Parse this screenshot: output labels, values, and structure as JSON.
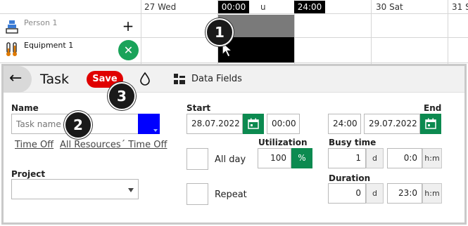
{
  "timeline": {
    "days": [
      {
        "label": "27 Wed"
      },
      {
        "label": "u"
      },
      {
        "label": "30 Sat"
      },
      {
        "label": "31 S"
      }
    ],
    "time_badges": {
      "start": "00:00",
      "end": "24:00"
    },
    "resources": [
      {
        "name": "Person 1",
        "icon": "person-icon",
        "action": "+"
      },
      {
        "name": "Equipment 1",
        "icon": "equipment-icon",
        "action": "✕"
      }
    ],
    "colors": {
      "selection": "#000000",
      "existing_block": "#7a7a7a",
      "remove_button": "#1aa35a"
    }
  },
  "markers": [
    "1",
    "2",
    "3"
  ],
  "dialog": {
    "title": "Task",
    "save_label": "Save",
    "data_fields_label": "Data Fields",
    "name": {
      "label": "Name",
      "placeholder": "Task name",
      "value": "",
      "color": "#0000ff"
    },
    "links": {
      "time_off": "Time Off",
      "all_time_off": "All Resources´ Time Off"
    },
    "project": {
      "label": "Project",
      "value": ""
    },
    "start": {
      "label": "Start",
      "date": "28.07.2022",
      "time": "00:00"
    },
    "end": {
      "label": "End",
      "date": "29.07.2022",
      "time": "24:00"
    },
    "all_day": {
      "label": "All day",
      "checked": false
    },
    "repeat": {
      "label": "Repeat",
      "checked": false
    },
    "utilization": {
      "label": "Utilization",
      "value": "100",
      "unit": "%"
    },
    "busy_time": {
      "label": "Busy time",
      "days": "1",
      "days_unit": "d",
      "hm": "0:0",
      "hm_unit": "h:m"
    },
    "duration": {
      "label": "Duration",
      "days": "0",
      "days_unit": "d",
      "hm": "23:0",
      "hm_unit": "h:m"
    },
    "accent_color": "#0c8a50",
    "save_color": "#e00000"
  }
}
